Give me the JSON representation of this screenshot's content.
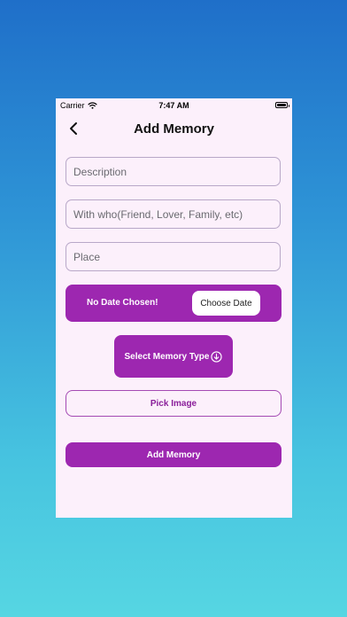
{
  "status_bar": {
    "carrier": "Carrier",
    "time": "7:47 AM"
  },
  "header": {
    "title": "Add Memory"
  },
  "form": {
    "description_placeholder": "Description",
    "with_who_placeholder": "With who(Friend, Lover, Family, etc)",
    "place_placeholder": "Place",
    "date_status": "No Date Chosen!",
    "choose_date_label": "Choose Date",
    "memory_type_label": "Select Memory Type",
    "pick_image_label": "Pick Image",
    "submit_label": "Add Memory"
  },
  "icons": {
    "wifi": "wifi-icon",
    "battery": "battery-icon",
    "back": "chevron-left-icon",
    "memory_type": "circle-arrow-down-icon"
  },
  "colors": {
    "accent": "#9d27b0",
    "card_background": "#fcf0fb",
    "background_top": "#1f6fc9",
    "background_bottom": "#56d6e2"
  }
}
